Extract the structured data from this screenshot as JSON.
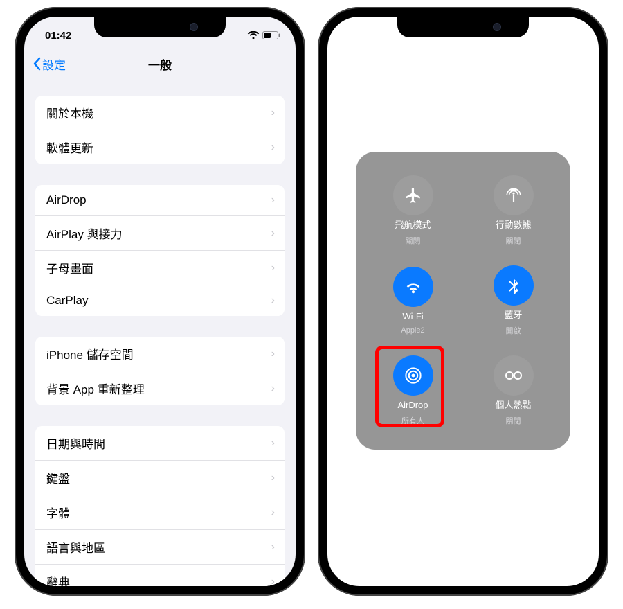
{
  "status": {
    "time": "01:42"
  },
  "nav": {
    "back": "設定",
    "title": "一般"
  },
  "groups": {
    "g1": {
      "about": "關於本機",
      "update": "軟體更新"
    },
    "g2": {
      "airdrop": "AirDrop",
      "airplay": "AirPlay 與接力",
      "pip": "子母畫面",
      "carplay": "CarPlay"
    },
    "g3": {
      "storage": "iPhone 儲存空間",
      "bgrefresh": "背景 App 重新整理"
    },
    "g4": {
      "datetime": "日期與時間",
      "keyboard": "鍵盤",
      "fonts": "字體",
      "language": "語言與地區",
      "dict": "辭典"
    }
  },
  "cc": {
    "airplane": {
      "label": "飛航模式",
      "sub": "關閉"
    },
    "cellular": {
      "label": "行動數據",
      "sub": "關閉"
    },
    "wifi": {
      "label": "Wi-Fi",
      "sub": "Apple2"
    },
    "bt": {
      "label": "藍牙",
      "sub": "開啟"
    },
    "airdrop": {
      "label": "AirDrop",
      "sub": "所有人"
    },
    "hotspot": {
      "label": "個人熱點",
      "sub": "關閉"
    }
  }
}
